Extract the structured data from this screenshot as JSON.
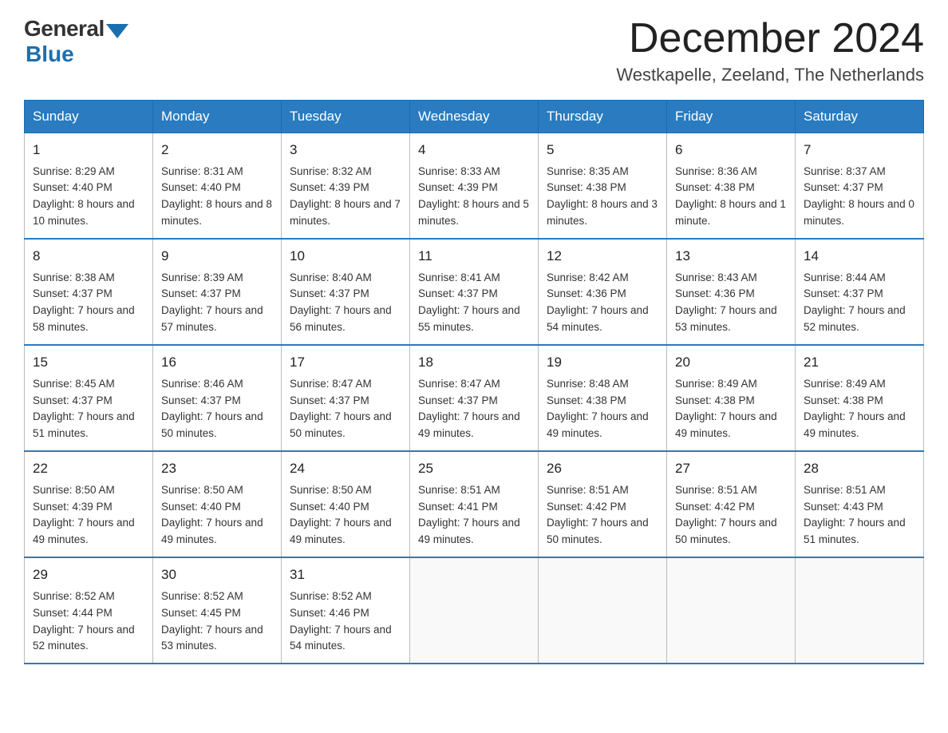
{
  "logo": {
    "general": "General",
    "blue": "Blue"
  },
  "header": {
    "month_year": "December 2024",
    "location": "Westkapelle, Zeeland, The Netherlands"
  },
  "days_of_week": [
    "Sunday",
    "Monday",
    "Tuesday",
    "Wednesday",
    "Thursday",
    "Friday",
    "Saturday"
  ],
  "weeks": [
    [
      {
        "day": "1",
        "sunrise": "8:29 AM",
        "sunset": "4:40 PM",
        "daylight": "8 hours and 10 minutes."
      },
      {
        "day": "2",
        "sunrise": "8:31 AM",
        "sunset": "4:40 PM",
        "daylight": "8 hours and 8 minutes."
      },
      {
        "day": "3",
        "sunrise": "8:32 AM",
        "sunset": "4:39 PM",
        "daylight": "8 hours and 7 minutes."
      },
      {
        "day": "4",
        "sunrise": "8:33 AM",
        "sunset": "4:39 PM",
        "daylight": "8 hours and 5 minutes."
      },
      {
        "day": "5",
        "sunrise": "8:35 AM",
        "sunset": "4:38 PM",
        "daylight": "8 hours and 3 minutes."
      },
      {
        "day": "6",
        "sunrise": "8:36 AM",
        "sunset": "4:38 PM",
        "daylight": "8 hours and 1 minute."
      },
      {
        "day": "7",
        "sunrise": "8:37 AM",
        "sunset": "4:37 PM",
        "daylight": "8 hours and 0 minutes."
      }
    ],
    [
      {
        "day": "8",
        "sunrise": "8:38 AM",
        "sunset": "4:37 PM",
        "daylight": "7 hours and 58 minutes."
      },
      {
        "day": "9",
        "sunrise": "8:39 AM",
        "sunset": "4:37 PM",
        "daylight": "7 hours and 57 minutes."
      },
      {
        "day": "10",
        "sunrise": "8:40 AM",
        "sunset": "4:37 PM",
        "daylight": "7 hours and 56 minutes."
      },
      {
        "day": "11",
        "sunrise": "8:41 AM",
        "sunset": "4:37 PM",
        "daylight": "7 hours and 55 minutes."
      },
      {
        "day": "12",
        "sunrise": "8:42 AM",
        "sunset": "4:36 PM",
        "daylight": "7 hours and 54 minutes."
      },
      {
        "day": "13",
        "sunrise": "8:43 AM",
        "sunset": "4:36 PM",
        "daylight": "7 hours and 53 minutes."
      },
      {
        "day": "14",
        "sunrise": "8:44 AM",
        "sunset": "4:37 PM",
        "daylight": "7 hours and 52 minutes."
      }
    ],
    [
      {
        "day": "15",
        "sunrise": "8:45 AM",
        "sunset": "4:37 PM",
        "daylight": "7 hours and 51 minutes."
      },
      {
        "day": "16",
        "sunrise": "8:46 AM",
        "sunset": "4:37 PM",
        "daylight": "7 hours and 50 minutes."
      },
      {
        "day": "17",
        "sunrise": "8:47 AM",
        "sunset": "4:37 PM",
        "daylight": "7 hours and 50 minutes."
      },
      {
        "day": "18",
        "sunrise": "8:47 AM",
        "sunset": "4:37 PM",
        "daylight": "7 hours and 49 minutes."
      },
      {
        "day": "19",
        "sunrise": "8:48 AM",
        "sunset": "4:38 PM",
        "daylight": "7 hours and 49 minutes."
      },
      {
        "day": "20",
        "sunrise": "8:49 AM",
        "sunset": "4:38 PM",
        "daylight": "7 hours and 49 minutes."
      },
      {
        "day": "21",
        "sunrise": "8:49 AM",
        "sunset": "4:38 PM",
        "daylight": "7 hours and 49 minutes."
      }
    ],
    [
      {
        "day": "22",
        "sunrise": "8:50 AM",
        "sunset": "4:39 PM",
        "daylight": "7 hours and 49 minutes."
      },
      {
        "day": "23",
        "sunrise": "8:50 AM",
        "sunset": "4:40 PM",
        "daylight": "7 hours and 49 minutes."
      },
      {
        "day": "24",
        "sunrise": "8:50 AM",
        "sunset": "4:40 PM",
        "daylight": "7 hours and 49 minutes."
      },
      {
        "day": "25",
        "sunrise": "8:51 AM",
        "sunset": "4:41 PM",
        "daylight": "7 hours and 49 minutes."
      },
      {
        "day": "26",
        "sunrise": "8:51 AM",
        "sunset": "4:42 PM",
        "daylight": "7 hours and 50 minutes."
      },
      {
        "day": "27",
        "sunrise": "8:51 AM",
        "sunset": "4:42 PM",
        "daylight": "7 hours and 50 minutes."
      },
      {
        "day": "28",
        "sunrise": "8:51 AM",
        "sunset": "4:43 PM",
        "daylight": "7 hours and 51 minutes."
      }
    ],
    [
      {
        "day": "29",
        "sunrise": "8:52 AM",
        "sunset": "4:44 PM",
        "daylight": "7 hours and 52 minutes."
      },
      {
        "day": "30",
        "sunrise": "8:52 AM",
        "sunset": "4:45 PM",
        "daylight": "7 hours and 53 minutes."
      },
      {
        "day": "31",
        "sunrise": "8:52 AM",
        "sunset": "4:46 PM",
        "daylight": "7 hours and 54 minutes."
      },
      null,
      null,
      null,
      null
    ]
  ]
}
